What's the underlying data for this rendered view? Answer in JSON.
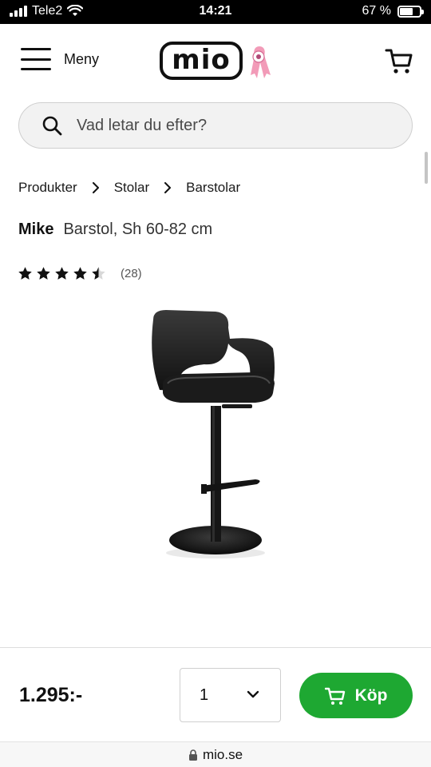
{
  "status_bar": {
    "carrier": "Tele2",
    "time": "14:21",
    "battery_text": "67 %",
    "battery_level": 0.67
  },
  "header": {
    "menu_label": "Meny",
    "logo_text": "mio"
  },
  "search": {
    "placeholder": "Vad letar du efter?"
  },
  "breadcrumb": [
    "Produkter",
    "Stolar",
    "Barstolar"
  ],
  "product": {
    "brand": "Mike",
    "description": "Barstol, Sh 60-82 cm",
    "rating": 4.5,
    "review_count": "(28)"
  },
  "purchase": {
    "price": "1.295:-",
    "quantity": "1",
    "buy_label": "Köp"
  },
  "browser": {
    "url": "mio.se"
  },
  "colors": {
    "buy_button": "#1ea832",
    "status_bar": "#000000",
    "ribbon": "#f29bb8"
  },
  "icons": {
    "menu": "hamburger-icon",
    "cart": "cart-icon",
    "search": "search-icon",
    "chevron": "chevron-right-icon",
    "select": "chevron-down-icon",
    "lock": "lock-icon"
  }
}
